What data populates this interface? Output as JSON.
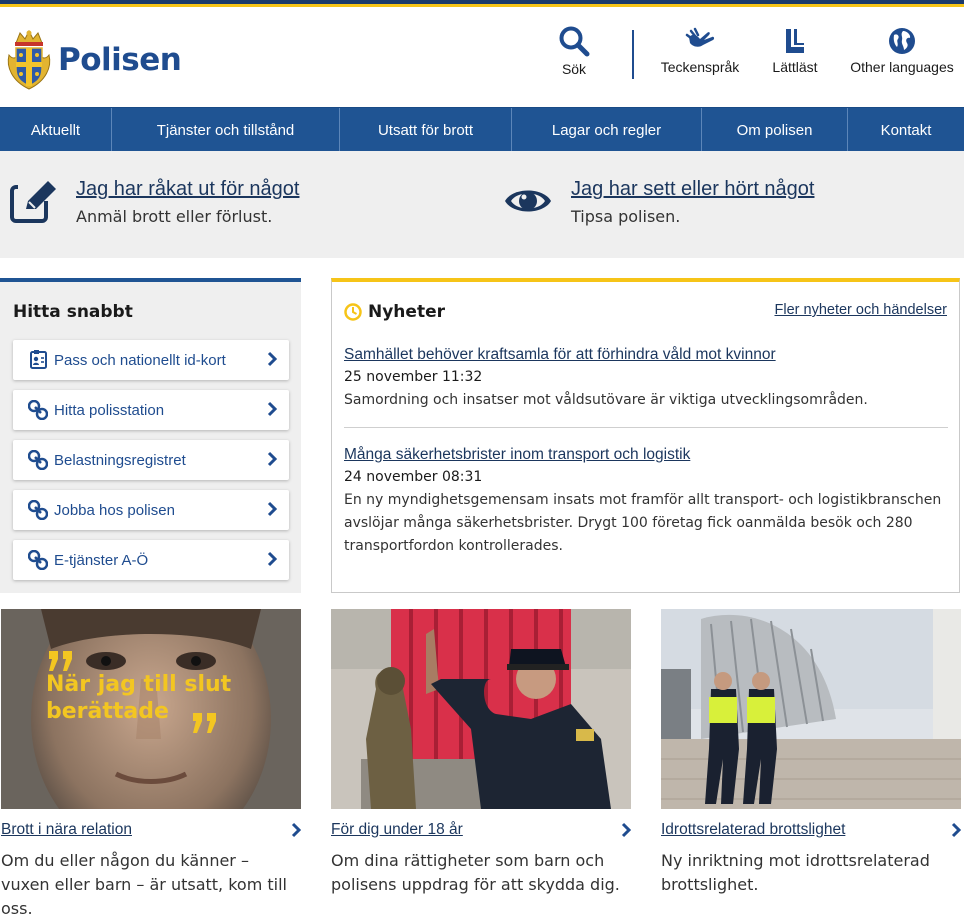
{
  "site": {
    "name": "Polisen"
  },
  "tools": [
    {
      "label": "Sök",
      "icon": "search-icon"
    },
    {
      "label": "Teckenspråk",
      "icon": "sign-language-icon"
    },
    {
      "label": "Lättläst",
      "icon": "easy-read-icon"
    },
    {
      "label": "Other languages",
      "icon": "globe-icon"
    }
  ],
  "nav": [
    "Aktuellt",
    "Tjänster och tillstånd",
    "Utsatt för brott",
    "Lagar och regler",
    "Om polisen",
    "Kontakt"
  ],
  "cta": [
    {
      "title": "Jag har råkat ut för något",
      "sub": "Anmäl brott eller förlust.",
      "icon": "edit-icon"
    },
    {
      "title": "Jag har sett eller hört något",
      "sub": "Tipsa polisen.",
      "icon": "eye-icon"
    }
  ],
  "quick": {
    "title": "Hitta snabbt",
    "links": [
      {
        "label": "Pass och nationellt id-kort",
        "icon": "id-card-icon"
      },
      {
        "label": "Hitta polisstation",
        "icon": "link-icon"
      },
      {
        "label": "Belastningsregistret",
        "icon": "link-icon"
      },
      {
        "label": "Jobba hos polisen",
        "icon": "link-icon"
      },
      {
        "label": "E-tjänster A-Ö",
        "icon": "link-icon"
      }
    ]
  },
  "news": {
    "title": "Nyheter",
    "more": "Fler nyheter och händelser",
    "items": [
      {
        "title": "Samhället behöver kraftsamla för att förhindra våld mot kvinnor",
        "date": "25 november 11:32",
        "text": "Samordning och insatser mot våldsutövare är viktiga utvecklingsområden."
      },
      {
        "title": "Många säkerhetsbrister inom transport och logistik",
        "date": "24 november 08:31",
        "text": "En ny myndighetsgemensam insats mot framför allt transport- och logistikbranschen avslöjar många säkerhetsbrister. Drygt 100 företag fick oanmälda besök och 280 transportfordon kontrollerades."
      }
    ]
  },
  "cards": [
    {
      "title": "Brott i nära relation",
      "text": "Om du eller någon du känner – vuxen eller barn – är utsatt, kom till oss.",
      "image_text": "När jag till slut berättade"
    },
    {
      "title": "För dig under 18 år",
      "text": "Om dina rättigheter som barn och polisens uppdrag för att skydda dig."
    },
    {
      "title": "Idrottsrelaterad brottslighet",
      "text": "Ny inriktning mot idrottsrelaterad brottslighet."
    }
  ],
  "colors": {
    "brand": "#1f5493",
    "accent": "#f6c418",
    "link": "#1b365d"
  }
}
